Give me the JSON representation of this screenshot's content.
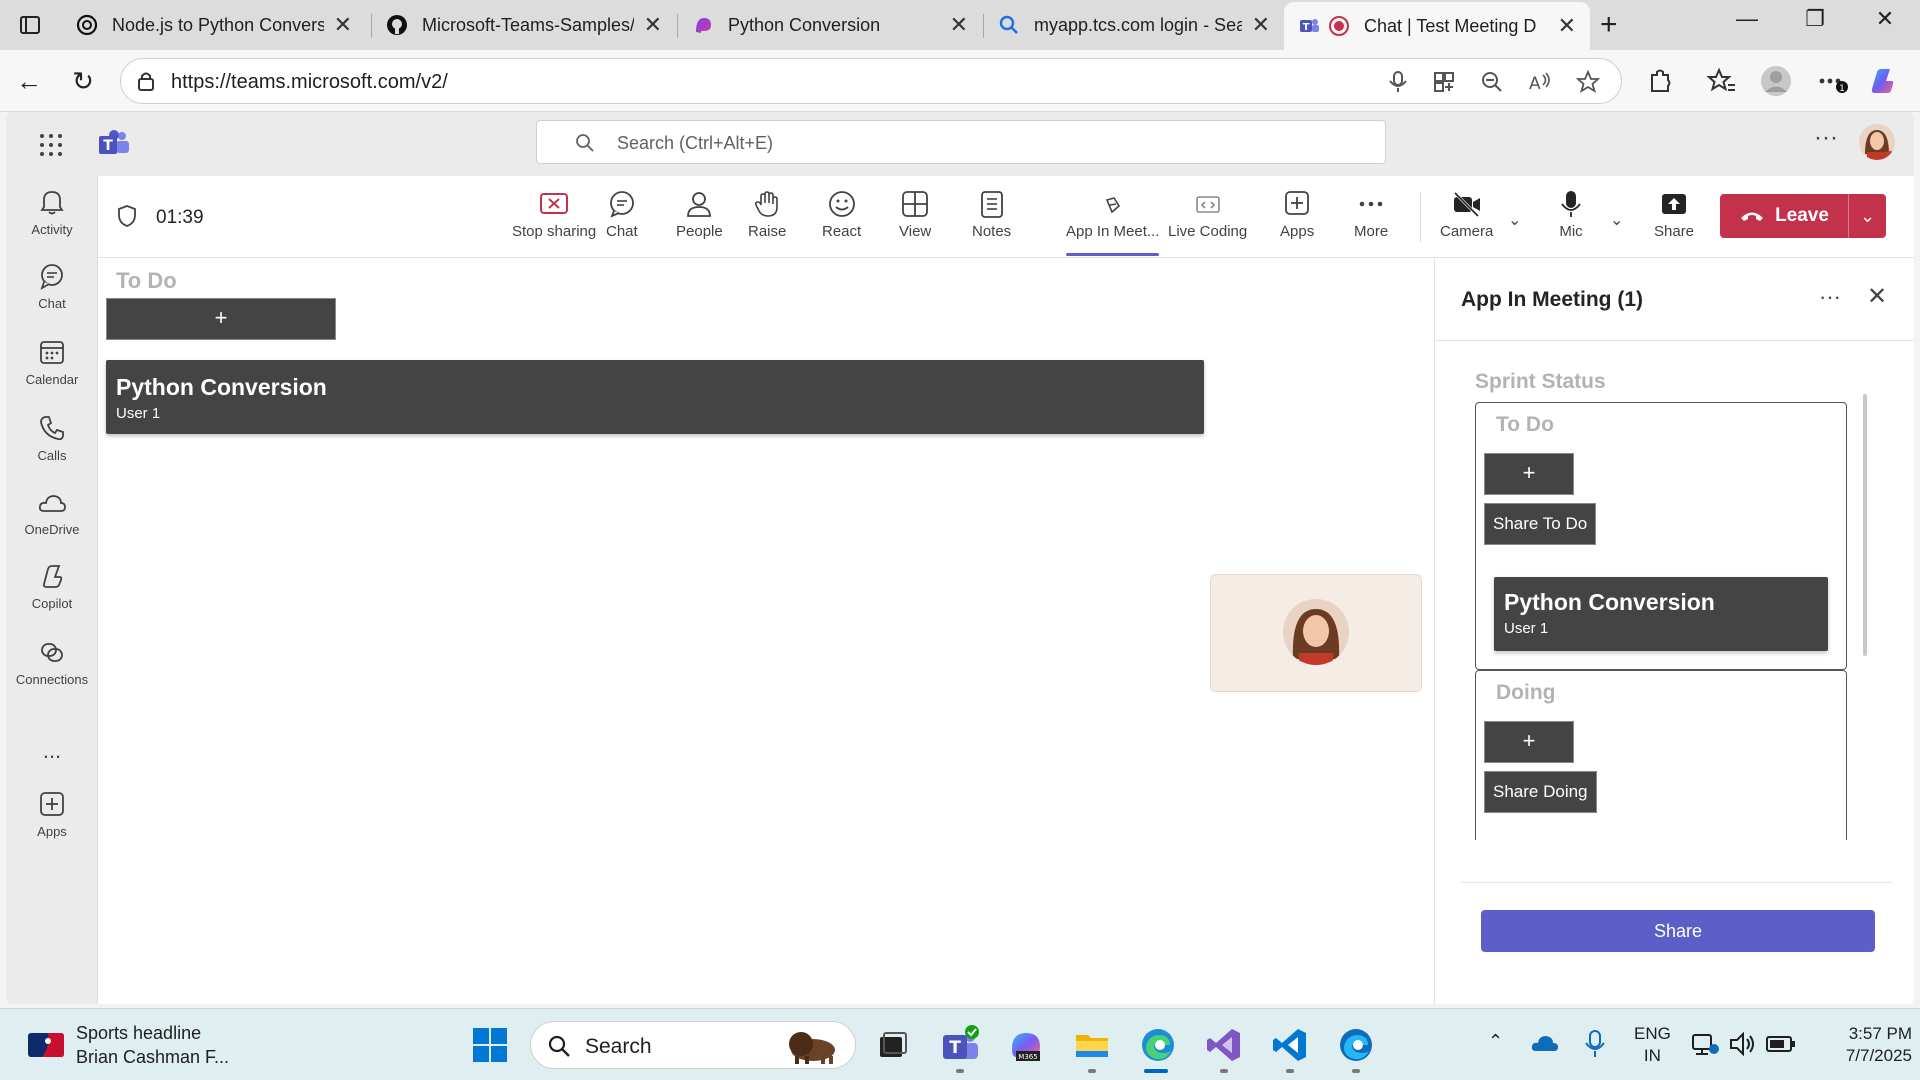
{
  "browser": {
    "tabs": [
      {
        "title": "Node.js to Python Convers",
        "icon": "chatgpt-icon",
        "active": false
      },
      {
        "title": "Microsoft-Teams-Samples/",
        "icon": "github-icon",
        "active": false
      },
      {
        "title": "Python Conversion",
        "icon": "copilot-app-icon",
        "active": false
      },
      {
        "title": "myapp.tcs.com login - Sear",
        "icon": "search-icon",
        "active": false
      },
      {
        "title": "Chat | Test Meeting D",
        "icon": "teams-icon",
        "active": true
      }
    ],
    "url": "https://teams.microsoft.com/v2/"
  },
  "teams": {
    "search_placeholder": "Search (Ctrl+Alt+E)",
    "rail": [
      {
        "label": "Activity",
        "icon": "bell-icon"
      },
      {
        "label": "Chat",
        "icon": "chat-icon"
      },
      {
        "label": "Calendar",
        "icon": "calendar-icon"
      },
      {
        "label": "Calls",
        "icon": "phone-icon"
      },
      {
        "label": "OneDrive",
        "icon": "cloud-icon"
      },
      {
        "label": "Copilot",
        "icon": "copilot-icon"
      },
      {
        "label": "Connections",
        "icon": "connections-icon"
      },
      {
        "label": "Apps",
        "icon": "add-apps-icon"
      }
    ],
    "rail_more": "...",
    "meeting": {
      "timer": "01:39",
      "controls": [
        {
          "label": "Stop sharing",
          "icon": "stop-sharing-icon"
        },
        {
          "label": "Chat",
          "icon": "chat-icon"
        },
        {
          "label": "People",
          "icon": "people-icon"
        },
        {
          "label": "Raise",
          "icon": "raise-hand-icon"
        },
        {
          "label": "React",
          "icon": "smile-icon"
        },
        {
          "label": "View",
          "icon": "view-grid-icon"
        },
        {
          "label": "Notes",
          "icon": "notes-icon"
        },
        {
          "label": "App In Meet...",
          "icon": "app-icon",
          "active": true
        },
        {
          "label": "Live Coding",
          "icon": "live-coding-icon"
        },
        {
          "label": "Apps",
          "icon": "add-icon"
        },
        {
          "label": "More",
          "icon": "more-icon"
        },
        {
          "label": "Camera",
          "icon": "camera-off-icon"
        },
        {
          "label": "Mic",
          "icon": "mic-icon"
        },
        {
          "label": "Share",
          "icon": "share-icon"
        }
      ],
      "leave_label": "Leave"
    },
    "stage": {
      "column_title": "To Do",
      "add_label": "+",
      "card": {
        "title": "Python Conversion",
        "subtitle": "User 1"
      }
    },
    "panel": {
      "title": "App In Meeting (1)",
      "sprint_title": "Sprint Status",
      "columns": [
        {
          "title": "To Do",
          "add_label": "+",
          "share_label": "Share To Do",
          "cards": [
            {
              "title": "Python Conversion",
              "subtitle": "User 1"
            }
          ]
        },
        {
          "title": "Doing",
          "add_label": "+",
          "share_label": "Share Doing",
          "cards": []
        }
      ],
      "share_button": "Share"
    }
  },
  "taskbar": {
    "news_headline": "Sports headline",
    "news_sub": "Brian Cashman F...",
    "search_label": "Search",
    "lang_top": "ENG",
    "lang_bottom": "IN",
    "time": "3:57 PM",
    "date": "7/7/2025"
  },
  "colors": {
    "teams_accent": "#5b5fc7",
    "leave_red": "#c4314b",
    "card_bg": "#444444"
  }
}
